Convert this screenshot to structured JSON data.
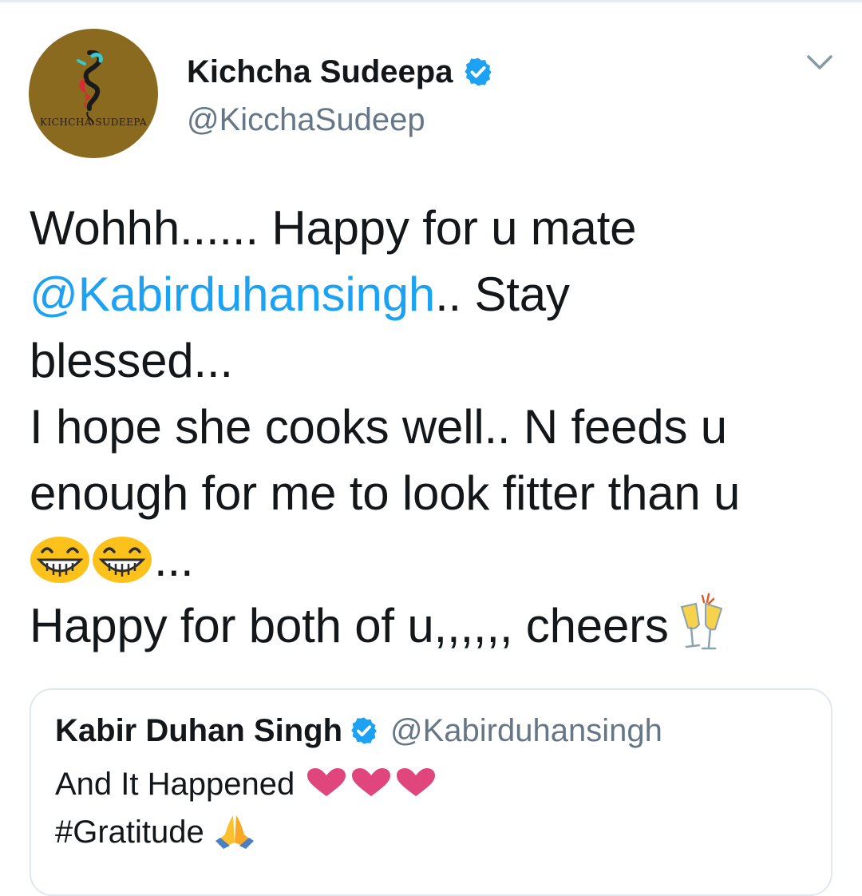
{
  "tweet": {
    "author": {
      "display_name": "Kichcha Sudeepa",
      "handle": "@KicchaSudeep",
      "avatar_text": "KICHCHA SUDEEPA",
      "verified": true
    },
    "text": {
      "line1": "Wohhh...... Happy for u mate",
      "mention": "@Kabirduhansingh",
      "line2_rest": ".. Stay",
      "line3": "blessed...",
      "line4": "I hope she cooks well.. N feeds u",
      "line5": "enough for me to look fitter than u",
      "line6_rest": "...",
      "line7": "Happy for both of u,,,,,, cheers"
    }
  },
  "quoted_tweet": {
    "display_name": "Kabir Duhan Singh",
    "handle": "@Kabirduhansingh",
    "verified": true,
    "line1": "And It Happened",
    "line2": "#Gratitude"
  },
  "icons": [
    "verified-badge-icon",
    "chevron-down-icon",
    "grinning-face-emoji",
    "champagne-glasses-emoji",
    "heart-emoji",
    "folded-hands-emoji"
  ],
  "colors": {
    "link": "#1da1f2",
    "verified": "#1da1f2",
    "secondary_text": "#657786",
    "heart": "#e0457b",
    "avatar_bg": "#8a6a1e"
  }
}
